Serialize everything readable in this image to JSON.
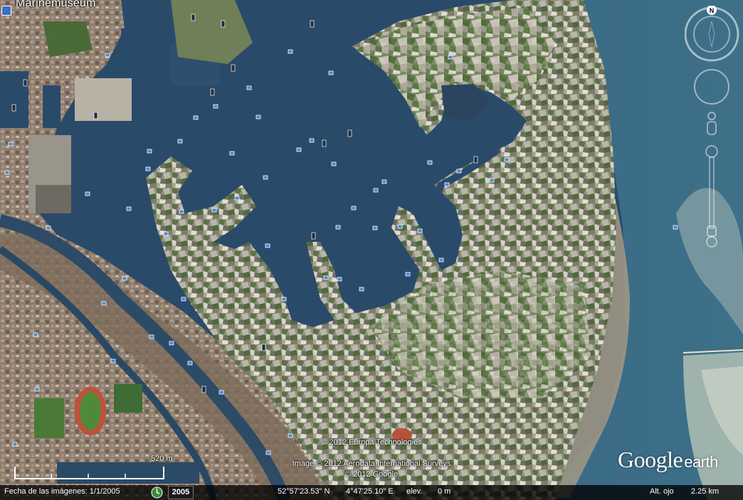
{
  "place_label": "Marinemuseum",
  "credits": {
    "line1": "© 2012 Europa Technologies",
    "line2": "Image © 2012 Aerodata International Surveys",
    "line3": "© 2012 Google"
  },
  "scale": {
    "label": "520 m"
  },
  "logo": {
    "google": "Google",
    "earth": "earth"
  },
  "status": {
    "image_date_label": "Fecha de las imágenes: 1/1/2005",
    "year": "2005",
    "latitude": "52°57'23.53\" N",
    "longitude": "4°47'25.10\" E",
    "elev_label": "elev.",
    "elev_value": "0 m",
    "eye_alt_label": "Alt. ojo",
    "eye_alt_value": "2.25 km"
  },
  "compass": {
    "north": "N"
  },
  "colors": {
    "water": "#2a4a6a",
    "sea": "#2e5a74",
    "land": "#8a8a78",
    "green": "#4f6b3a",
    "status_bar": "#000000"
  }
}
